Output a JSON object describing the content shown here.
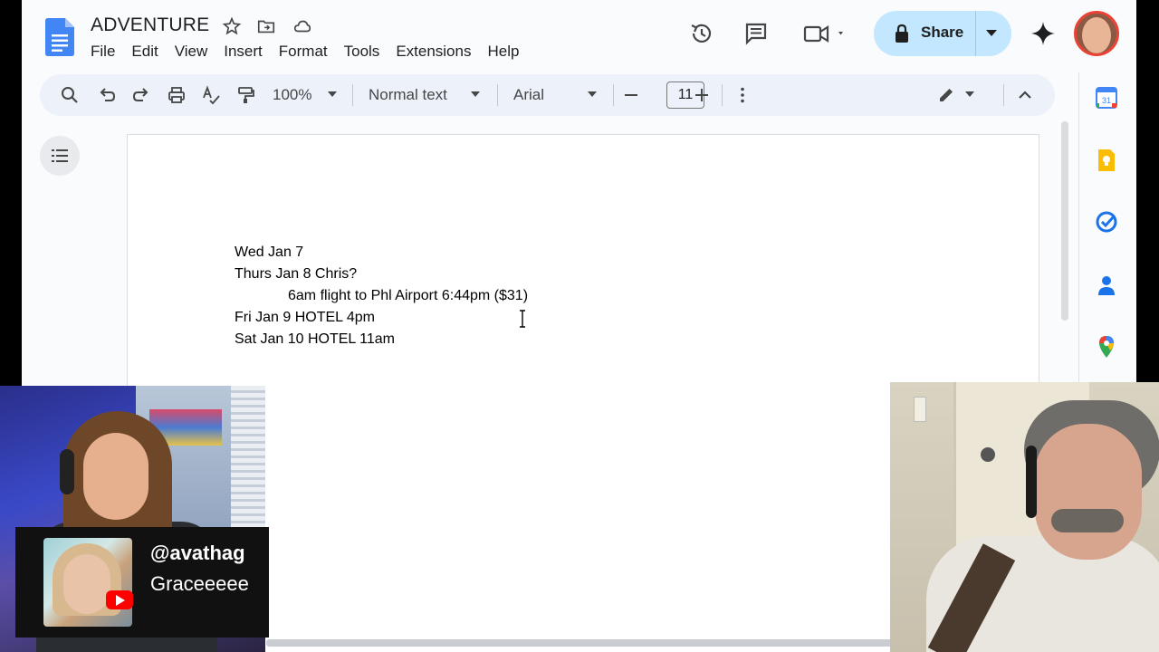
{
  "doc": {
    "title": "ADVENTURE",
    "menu": [
      "File",
      "Edit",
      "View",
      "Insert",
      "Format",
      "Tools",
      "Extensions",
      "Help"
    ],
    "share_label": "Share"
  },
  "toolbar": {
    "zoom": "100%",
    "style": "Normal text",
    "font": "Arial",
    "font_size": "11"
  },
  "document": {
    "lines": [
      "Wed Jan 7",
      "Thurs Jan 8 Chris?",
      "6am flight to Phl Airport 6:44pm ($31)",
      "Fri Jan 9 HOTEL 4pm",
      "Sat Jan 10 HOTEL 11am"
    ]
  },
  "side_panel": {
    "calendar_day": "31"
  },
  "overlay": {
    "handle": "@avathag",
    "name": "Graceeeee"
  },
  "colors": {
    "share_bg": "#c2e7ff",
    "toolbar_bg": "#edf2fa",
    "docs_blue": "#4285f4",
    "youtube_red": "#ff0000"
  }
}
